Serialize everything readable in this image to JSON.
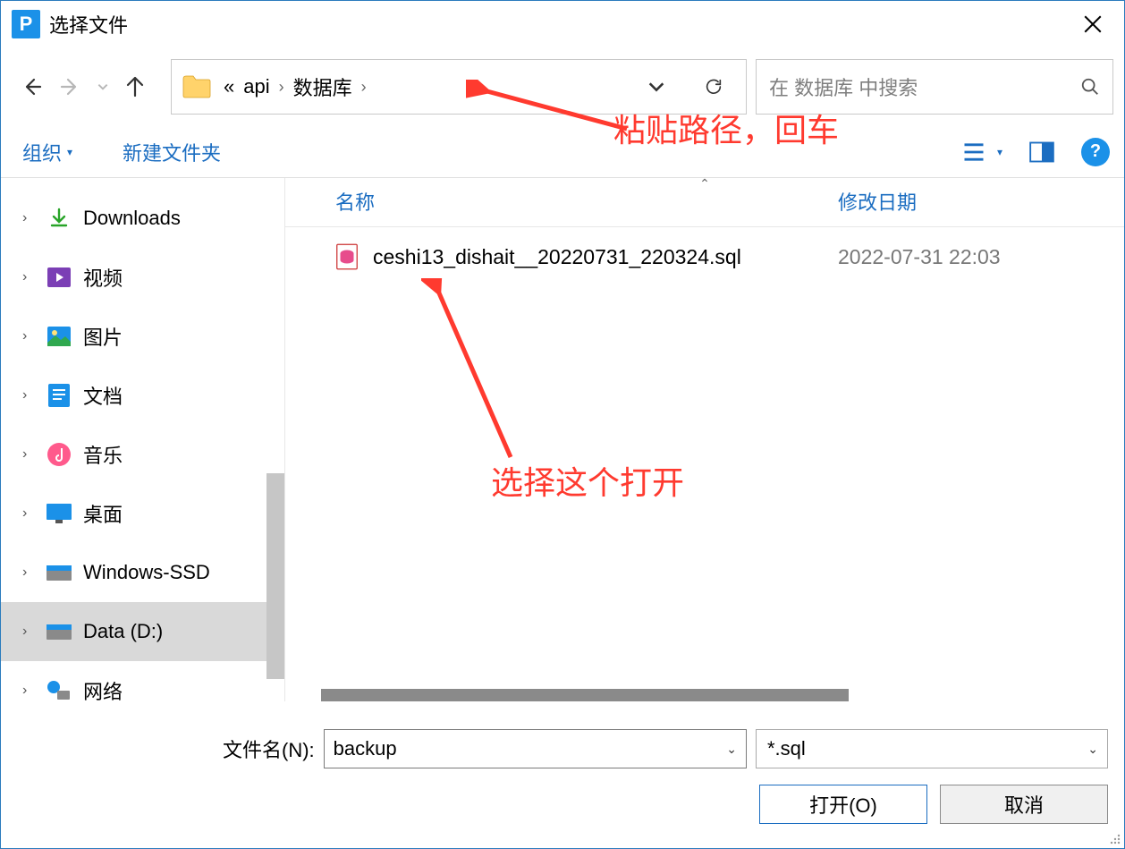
{
  "window": {
    "title": "选择文件",
    "app_icon_letter": "P"
  },
  "breadcrumb": {
    "prefix": "«",
    "items": [
      "api",
      "数据库"
    ]
  },
  "search": {
    "placeholder": "在 数据库 中搜索"
  },
  "toolbar": {
    "organize": "组织",
    "new_folder": "新建文件夹"
  },
  "tree": [
    {
      "label": "Downloads",
      "icon": "download"
    },
    {
      "label": "视频",
      "icon": "video"
    },
    {
      "label": "图片",
      "icon": "image"
    },
    {
      "label": "文档",
      "icon": "doc"
    },
    {
      "label": "音乐",
      "icon": "music"
    },
    {
      "label": "桌面",
      "icon": "desktop"
    },
    {
      "label": "Windows-SSD",
      "icon": "drive"
    },
    {
      "label": "Data (D:)",
      "icon": "drive",
      "selected": true
    },
    {
      "label": "网络",
      "icon": "network"
    }
  ],
  "columns": {
    "name": "名称",
    "date": "修改日期"
  },
  "files": [
    {
      "name": "ceshi13_dishait__20220731_220324.sql",
      "date": "2022-07-31 22:03"
    }
  ],
  "bottom": {
    "filename_label": "文件名(N):",
    "filename_value": "backup",
    "filter_value": "*.sql",
    "open_button": "打开(O)",
    "cancel_button": "取消"
  },
  "annotations": {
    "paste_path": "粘贴路径，回车",
    "select_open": "选择这个打开"
  }
}
